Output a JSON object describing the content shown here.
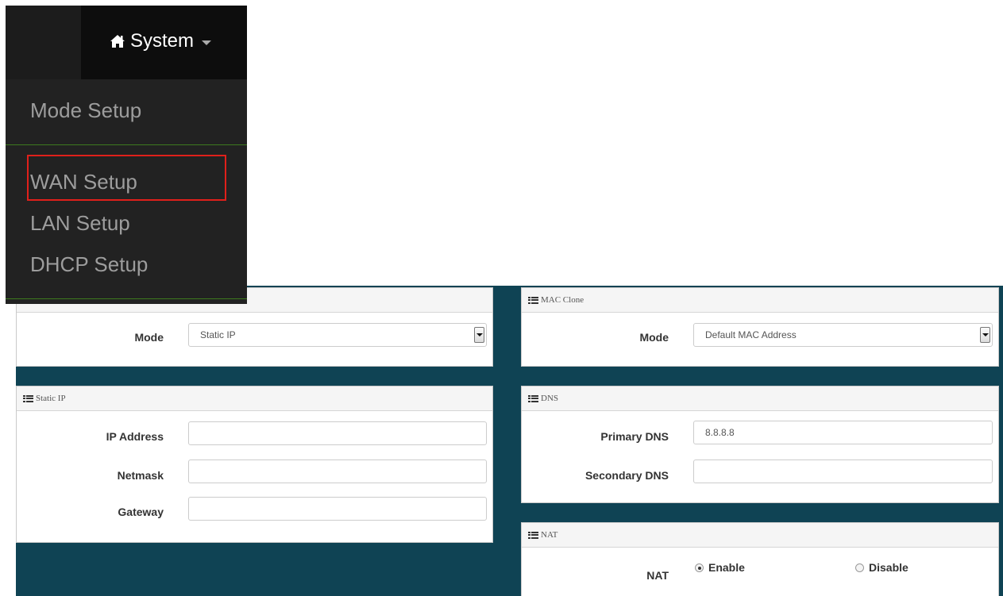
{
  "menu": {
    "title": "System",
    "items": [
      {
        "label": "Mode Setup"
      },
      {
        "label": "WAN Setup"
      },
      {
        "label": "LAN Setup"
      },
      {
        "label": "DHCP Setup"
      }
    ]
  },
  "connection_panel": {
    "mode_label": "Mode",
    "mode_value": "Static IP"
  },
  "static_ip_panel": {
    "title": "Static IP",
    "ip_label": "IP Address",
    "ip_value": "",
    "netmask_label": "Netmask",
    "netmask_value": "",
    "gateway_label": "Gateway",
    "gateway_value": ""
  },
  "mac_clone_panel": {
    "title": "MAC Clone",
    "mode_label": "Mode",
    "mode_value": "Default MAC Address"
  },
  "dns_panel": {
    "title": "DNS",
    "primary_label": "Primary DNS",
    "primary_value": "8.8.8.8",
    "secondary_label": "Secondary DNS",
    "secondary_value": ""
  },
  "nat_panel": {
    "title": "NAT",
    "label": "NAT",
    "enable_label": "Enable",
    "disable_label": "Disable",
    "selected": "Enable"
  },
  "colors": {
    "content_bg": "#0f4354",
    "menu_bg": "#222222",
    "highlight": "#e0201b"
  }
}
